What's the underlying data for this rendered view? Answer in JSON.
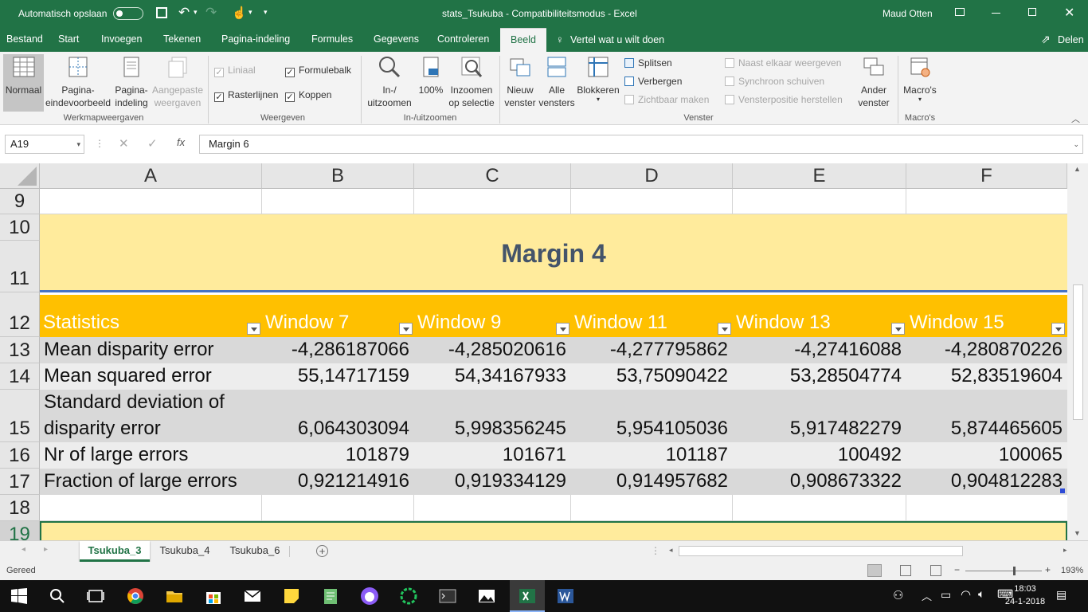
{
  "titlebar": {
    "autosave_label": "Automatisch opslaan",
    "autosave_state": "Uit",
    "title": "stats_Tsukuba  -  Compatibiliteitsmodus  -  Excel",
    "user": "Maud Otten"
  },
  "ribbon_tabs": [
    "Bestand",
    "Start",
    "Invoegen",
    "Tekenen",
    "Pagina-indeling",
    "Formules",
    "Gegevens",
    "Controleren",
    "Beeld"
  ],
  "active_tab": "Beeld",
  "tell_me": "Vertel wat u wilt doen",
  "share": "Delen",
  "ribbon": {
    "werkmap": {
      "label": "Werkmapweergaven",
      "normaal": "Normaal",
      "pagina_eind": "Pagina-\neindevoorbeeld",
      "pagina_ind": "Pagina-\nindeling",
      "aangepaste": "Aangepaste\nweergaven"
    },
    "weergeven": {
      "label": "Weergeven",
      "liniaal": "Liniaal",
      "formulebalk": "Formulebalk",
      "rasterlijnen": "Rasterlijnen",
      "koppen": "Koppen",
      "liniaal_checked": true,
      "formulebalk_checked": true,
      "rasterlijnen_checked": true,
      "koppen_checked": true
    },
    "zoom": {
      "label": "In-/uitzoomen",
      "in_uit": "In-/\nuitzoomen",
      "pct100": "100%",
      "selectie": "Inzoomen\nop selectie"
    },
    "venster": {
      "label": "Venster",
      "nieuw": "Nieuw\nvenster",
      "alle": "Alle\nvensters",
      "blokkeren": "Blokkeren",
      "splitsen": "Splitsen",
      "verbergen": "Verbergen",
      "zichtbaar": "Zichtbaar maken",
      "naast": "Naast elkaar weergeven",
      "synchroon": "Synchroon schuiven",
      "positie": "Vensterpositie herstellen",
      "ander": "Ander\nvenster"
    },
    "macros": {
      "label": "Macro's",
      "btn": "Macro's"
    }
  },
  "namebox": "A19",
  "formula": "Margin 6",
  "columns": [
    "A",
    "B",
    "C",
    "D",
    "E",
    "F"
  ],
  "rows": [
    "9",
    "10",
    "11",
    "12",
    "13",
    "14",
    "15",
    "16",
    "17",
    "18",
    "19"
  ],
  "section_title": "Margin 4",
  "table": {
    "headers": [
      "Statistics",
      "Window 7",
      "Window 9",
      "Window 11",
      "Window 13",
      "Window 15"
    ],
    "body": [
      {
        "label": [
          "Mean disparity error"
        ],
        "values": [
          "-4,286187066",
          "-4,285020616",
          "-4,277795862",
          "-4,27416088",
          "-4,280870226"
        ]
      },
      {
        "label": [
          "Mean squared error"
        ],
        "values": [
          "55,14717159",
          "54,34167933",
          "53,75090422",
          "53,28504774",
          "52,83519604"
        ]
      },
      {
        "label": [
          "Standard deviation of",
          "disparity error"
        ],
        "values": [
          "6,064303094",
          "5,998356245",
          "5,954105036",
          "5,917482279",
          "5,874465605"
        ]
      },
      {
        "label": [
          "Nr of large errors"
        ],
        "values": [
          "101879",
          "101671",
          "101187",
          "100492",
          "100065"
        ]
      },
      {
        "label": [
          "Fraction of large errors"
        ],
        "values": [
          "0,921214916",
          "0,919334129",
          "0,914957682",
          "0,908673322",
          "0,904812283"
        ]
      }
    ]
  },
  "sheets": [
    "Tsukuba_3",
    "Tsukuba_4",
    "Tsukuba_6"
  ],
  "active_sheet": "Tsukuba_3",
  "status": {
    "ready": "Gereed",
    "zoom": "193%"
  },
  "taskbar": {
    "time": "18:03",
    "date": "24-1-2018"
  },
  "colors": {
    "excel_green": "#217346",
    "title_fill": "#ffeb9c",
    "header_fill": "#ffc000",
    "band_dark": "#d9d9d9",
    "band_light": "#ededed",
    "title_text": "#44546a"
  }
}
